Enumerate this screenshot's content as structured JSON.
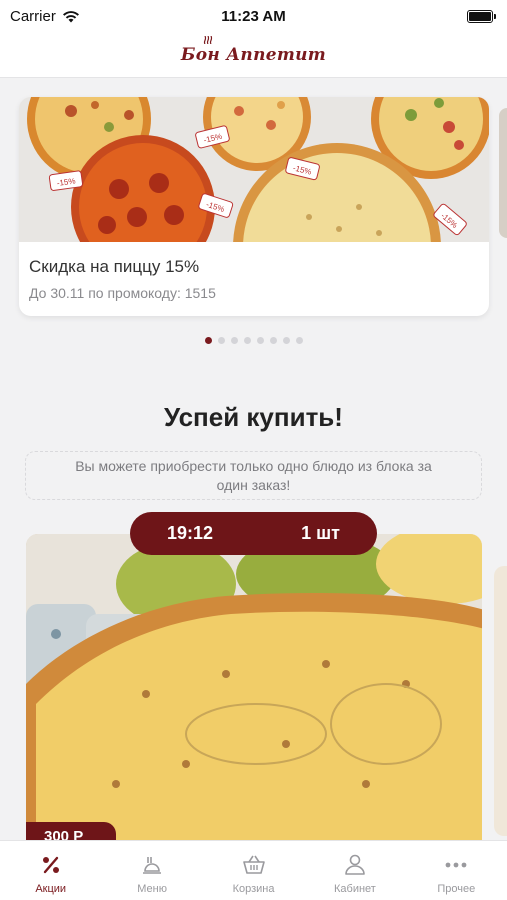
{
  "status_bar": {
    "carrier": "Carrier",
    "time": "11:23 AM"
  },
  "header": {
    "logo_text": "Бон Аппетит"
  },
  "promo": {
    "title": "Скидка на пиццу 15%",
    "subtitle": "До 30.11 по промокоду: 1515",
    "badge_text": "-15%",
    "dots_count": 8,
    "active_dot": 0
  },
  "section": {
    "title": "Успей купить!",
    "notice": "Вы можете приобрести только одно блюдо из блока за один заказ!"
  },
  "deal": {
    "timer": "19:12",
    "quantity": "1 шт",
    "price": "300 Р"
  },
  "tabs": [
    {
      "label": "Акции",
      "icon": "percent-icon",
      "active": true
    },
    {
      "label": "Меню",
      "icon": "menu-food-icon",
      "active": false
    },
    {
      "label": "Корзина",
      "icon": "basket-icon",
      "active": false
    },
    {
      "label": "Кабинет",
      "icon": "user-icon",
      "active": false
    },
    {
      "label": "Прочее",
      "icon": "more-icon",
      "active": false
    }
  ],
  "colors": {
    "brand": "#7a1a1e",
    "background": "#f2f2f3",
    "inactive": "#9a9a9e"
  }
}
